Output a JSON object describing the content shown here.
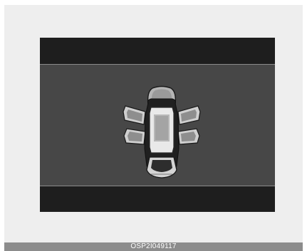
{
  "caption": {
    "code": "OSP2I049117"
  },
  "display": {
    "icon": "car-top-view-all-doors-open-icon"
  }
}
